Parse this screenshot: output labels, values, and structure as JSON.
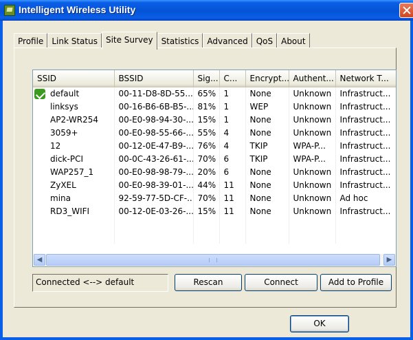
{
  "window": {
    "title": "Intelligent Wireless Utility"
  },
  "tabs": [
    {
      "label": "Profile"
    },
    {
      "label": "Link Status"
    },
    {
      "label": "Site Survey"
    },
    {
      "label": "Statistics"
    },
    {
      "label": "Advanced"
    },
    {
      "label": "QoS"
    },
    {
      "label": "About"
    }
  ],
  "active_tab": "Site Survey",
  "list": {
    "columns": [
      "SSID",
      "BSSID",
      "Sig...",
      "C...",
      "Encrypt...",
      "Authent...",
      "Network T..."
    ],
    "rows": [
      {
        "ssid": "default",
        "bssid": "00-11-D8-8D-55...",
        "signal": "65%",
        "channel": "1",
        "encryption": "None",
        "auth": "Unknown",
        "network_type": "Infrastruct...",
        "connected": true
      },
      {
        "ssid": "linksys",
        "bssid": "00-16-B6-6B-B5-...",
        "signal": "81%",
        "channel": "1",
        "encryption": "WEP",
        "auth": "Unknown",
        "network_type": "Infrastruct..."
      },
      {
        "ssid": "AP2-WR254",
        "bssid": "00-E0-98-94-30-...",
        "signal": "15%",
        "channel": "1",
        "encryption": "None",
        "auth": "Unknown",
        "network_type": "Infrastruct..."
      },
      {
        "ssid": "3059+",
        "bssid": "00-E0-98-55-66-...",
        "signal": "55%",
        "channel": "4",
        "encryption": "None",
        "auth": "Unknown",
        "network_type": "Infrastruct..."
      },
      {
        "ssid": "12",
        "bssid": "00-12-0E-47-B9-...",
        "signal": "76%",
        "channel": "4",
        "encryption": "TKIP",
        "auth": "WPA-P...",
        "network_type": "Infrastruct..."
      },
      {
        "ssid": "dick-PCI",
        "bssid": "00-0C-43-26-61-...",
        "signal": "70%",
        "channel": "6",
        "encryption": "TKIP",
        "auth": "WPA-P...",
        "network_type": "Infrastruct..."
      },
      {
        "ssid": "WAP257_1",
        "bssid": "00-E0-98-98-79-...",
        "signal": "20%",
        "channel": "6",
        "encryption": "None",
        "auth": "Unknown",
        "network_type": "Infrastruct..."
      },
      {
        "ssid": "ZyXEL",
        "bssid": "00-E0-98-39-01-...",
        "signal": "44%",
        "channel": "11",
        "encryption": "None",
        "auth": "Unknown",
        "network_type": "Infrastruct..."
      },
      {
        "ssid": "mina",
        "bssid": "92-59-77-5D-CF-...",
        "signal": "70%",
        "channel": "11",
        "encryption": "None",
        "auth": "Unknown",
        "network_type": "Ad hoc"
      },
      {
        "ssid": "RD3_WIFI",
        "bssid": "00-12-0E-03-26-...",
        "signal": "15%",
        "channel": "11",
        "encryption": "None",
        "auth": "Unknown",
        "network_type": "Infrastruct..."
      }
    ]
  },
  "status": {
    "text": "Connected <--> default"
  },
  "buttons": {
    "rescan": "Rescan",
    "connect": "Connect",
    "add_to_profile": "Add to Profile",
    "ok": "OK"
  },
  "icons": {
    "title": "wireless-utility-icon",
    "close": "close-icon",
    "connected": "connected-check-icon",
    "scroll_left": "arrow-left-icon",
    "scroll_right": "arrow-right-icon"
  },
  "colors": {
    "titlebar": "#0a5fe8",
    "window_bg": "#ece9d8",
    "close_button": "#d2451f",
    "connected_icon": "#3a9a1f"
  }
}
